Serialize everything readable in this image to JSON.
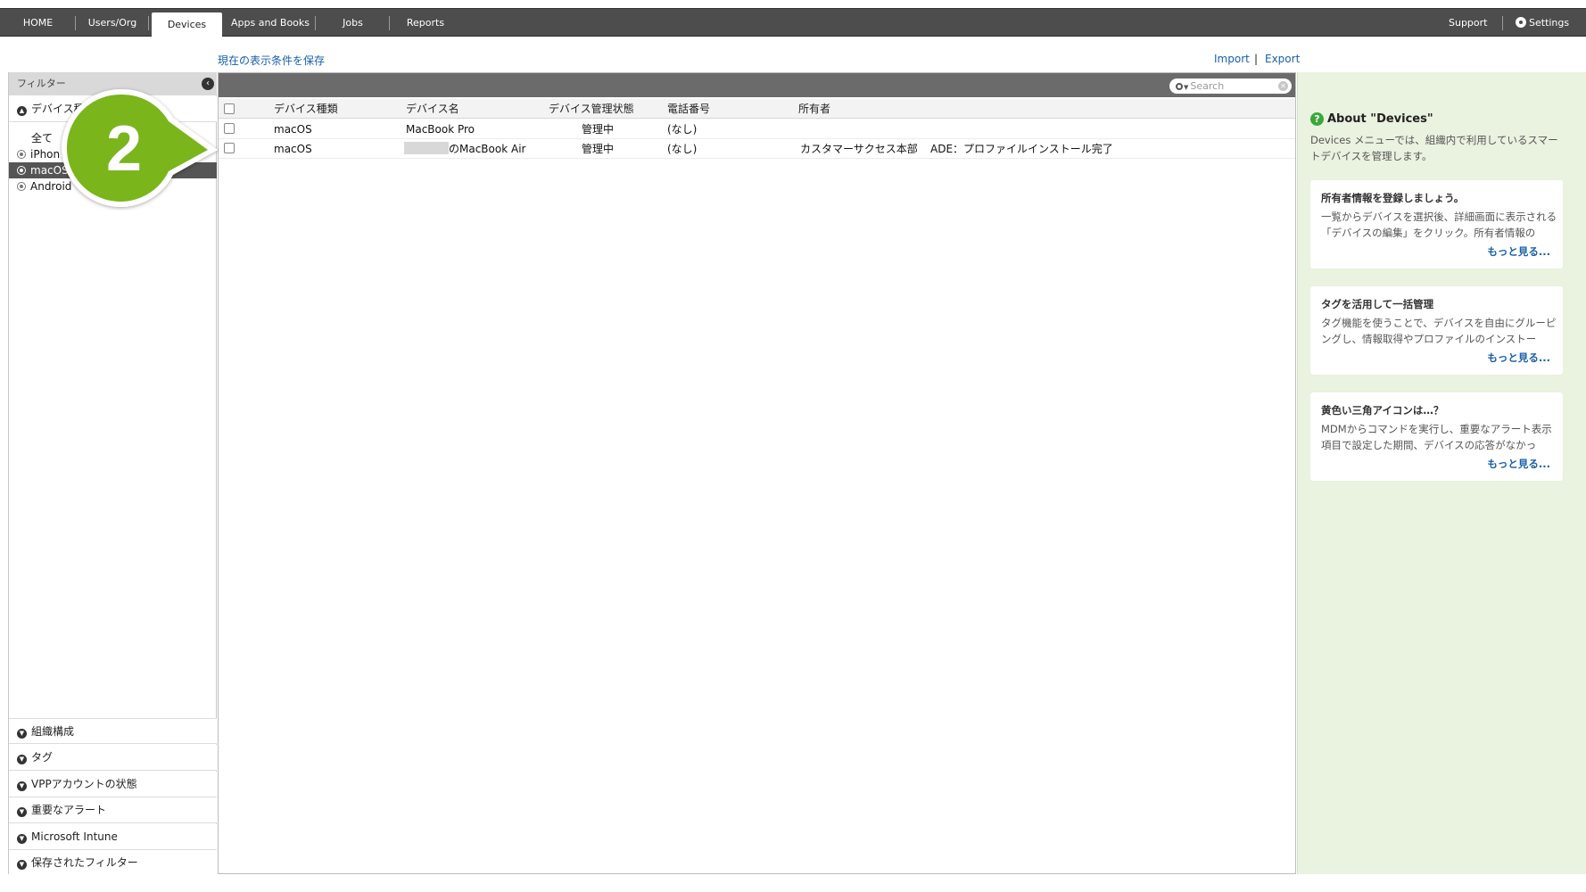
{
  "nav": {
    "tabs": [
      {
        "label": "HOME"
      },
      {
        "label": "Users/Org"
      },
      {
        "label": "Devices"
      },
      {
        "label": "Apps and Books"
      },
      {
        "label": "Jobs"
      },
      {
        "label": "Reports"
      }
    ],
    "support": "Support",
    "settings": "Settings"
  },
  "links": {
    "save_view": "現在の表示条件を保存",
    "import": "Import",
    "export": "Export",
    "separator": "|"
  },
  "filter": {
    "header": "フィルター",
    "device_type_section": "デバイス種",
    "items": [
      {
        "label": "全て"
      },
      {
        "label": "iPhon"
      },
      {
        "label": "macOS"
      },
      {
        "label": "Android"
      }
    ],
    "sections": [
      {
        "label": "組織構成"
      },
      {
        "label": "タグ"
      },
      {
        "label": "VPPアカウントの状態"
      },
      {
        "label": "重要なアラート"
      },
      {
        "label": "Microsoft Intune"
      },
      {
        "label": "保存されたフィルター"
      }
    ]
  },
  "search": {
    "placeholder": "Search"
  },
  "table": {
    "headers": [
      "デバイス種類",
      "デバイス名",
      "デバイス管理状態",
      "電話番号",
      "所有者"
    ],
    "rows": [
      {
        "type": "macOS",
        "name": "MacBook Pro",
        "status": "管理中",
        "phone": "(なし)",
        "owner": "",
        "note": ""
      },
      {
        "type": "macOS",
        "name": "のMacBook Air",
        "status": "管理中",
        "phone": "(なし)",
        "owner": "カスタマーサクセス本部",
        "note": "ADE：プロファイルインストール完了"
      }
    ]
  },
  "info": {
    "title": "About \"Devices\"",
    "description": "Devices メニューでは、組織内で利用しているスマートデバイスを管理します。",
    "cards": [
      {
        "title": "所有者情報を登録しましょう。",
        "text": "一覧からデバイスを選択後、詳細画面に表示される「デバイスの編集」をクリック。所有者情報の",
        "more": "もっと見る..."
      },
      {
        "title": "タグを活用して一括管理",
        "text": "タグ機能を使うことで、デバイスを自由にグルーピングし、情報取得やプロファイルのインストー",
        "more": "もっと見る..."
      },
      {
        "title": "黄色い三角アイコンは…？",
        "text": "MDMからコマンドを実行し、重要なアラート表示項目で設定した期間、デバイスの応答がなかっ",
        "more": "もっと見る..."
      }
    ]
  },
  "callout": {
    "number": "2"
  },
  "colors": {
    "accent_green": "#7ab51d",
    "link_blue": "#1a5fa8",
    "nav_bg": "#4d4d4d",
    "info_bg": "#eaf2e0"
  }
}
